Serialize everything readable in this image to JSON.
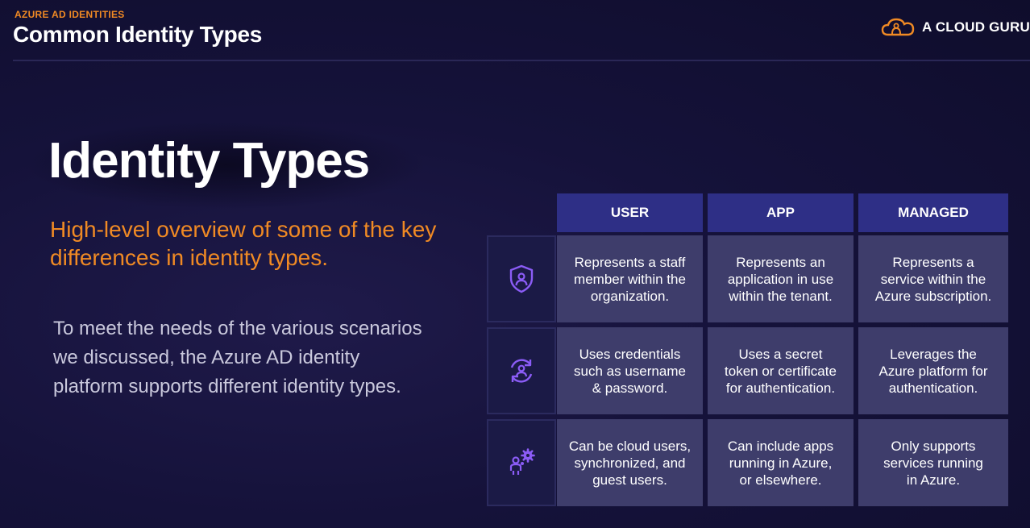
{
  "header": {
    "kicker": "AZURE AD IDENTITIES",
    "title": "Common Identity Types",
    "brand": "A CLOUD GURU"
  },
  "main": {
    "title": "Identity Types",
    "subtitle": "High-level overview of some of the key differences in identity types.",
    "body": "To meet the needs of the various scenarios we discussed, the Azure AD identity platform supports different identity types."
  },
  "table": {
    "columns": [
      "USER",
      "APP",
      "MANAGED"
    ],
    "rows": [
      {
        "icon": "shield-user-icon",
        "cells": [
          "Represents a staff\nmember within the\norganization.",
          "Represents an\napplication in use\nwithin the tenant.",
          "Represents a\nservice within the\nAzure subscription."
        ]
      },
      {
        "icon": "user-sync-icon",
        "cells": [
          "Uses credentials\nsuch as username\n& password.",
          "Uses a secret\ntoken or certificate\nfor authentication.",
          "Leverages the\nAzure platform for\nauthentication."
        ]
      },
      {
        "icon": "user-gear-icon",
        "cells": [
          "Can be cloud users,\nsynchronized, and\nguest users.",
          "Can include apps\nrunning in Azure,\nor elsewhere.",
          "Only supports\nservices running\nin Azure."
        ]
      }
    ]
  },
  "colors": {
    "accent_orange": "#f08a24",
    "header_blue": "#2e2f86",
    "cell_bg": "#3e3d6b",
    "icon_purple": "#8b5cf6"
  }
}
